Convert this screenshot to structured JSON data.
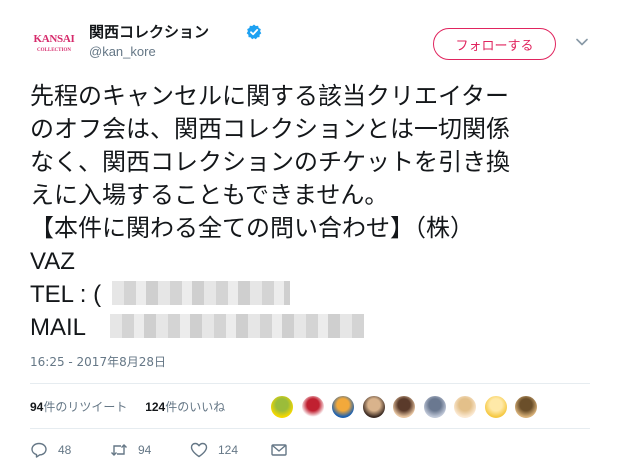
{
  "user": {
    "avatar_text": "KANSAI",
    "avatar_subtext": "COLLECTION",
    "display_name": "関西コレクション",
    "handle": "@kan_kore"
  },
  "follow_label": "フォローする",
  "tweet": {
    "lines": [
      "先程のキャンセルに関する該当クリエイター",
      "のオフ会は、関西コレクションとは一切関係",
      "なく、関西コレクションのチケットを引き換",
      "えに入場することもできません。",
      "【本件に関わる全ての問い合わせ】（株）"
    ],
    "company": "VAZ",
    "tel_label": "TEL : (",
    "mail_label": "MAIL"
  },
  "timestamp": "16:25 - 2017年8月28日",
  "stats": {
    "retweets_count": "94",
    "retweets_label": "件のリツイート",
    "likes_count": "124",
    "likes_label": "件のいいね"
  },
  "actions": {
    "reply_count": "48",
    "retweet_count": "94",
    "like_count": "124"
  },
  "colors": {
    "accent_pink": "#e0245e",
    "verified_blue": "#1da1f2",
    "muted_gray": "#657786"
  },
  "liker_avatars": [
    {
      "colors": [
        "#f5d800",
        "#9bbc3a"
      ]
    },
    {
      "colors": [
        "#ffffff",
        "#c02030"
      ]
    },
    {
      "colors": [
        "#1a5fb0",
        "#f2a93b"
      ]
    },
    {
      "colors": [
        "#3b2a22",
        "#d9b38c"
      ]
    },
    {
      "colors": [
        "#e9c7a3",
        "#5a3a2a"
      ]
    },
    {
      "colors": [
        "#c0c8d8",
        "#6a7890"
      ]
    },
    {
      "colors": [
        "#fbe9d2",
        "#e3c08a"
      ]
    },
    {
      "colors": [
        "#f5c842",
        "#ffe9a8"
      ]
    },
    {
      "colors": [
        "#d9b27a",
        "#6b4f2a"
      ]
    }
  ]
}
